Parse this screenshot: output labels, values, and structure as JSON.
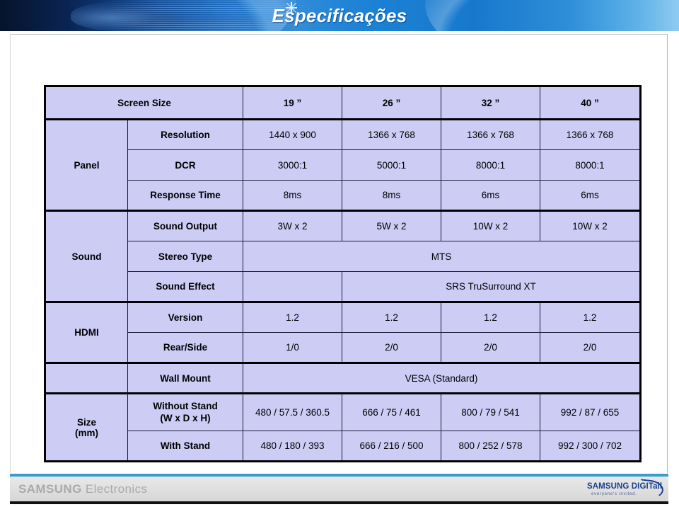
{
  "header": {
    "title": "Especificações",
    "sparkle_icon": "sparkle-icon"
  },
  "table": {
    "header_label": "Screen Size",
    "screen_sizes": [
      "19 ”",
      "26 ”",
      "32 ”",
      "40 ”"
    ],
    "categories": [
      "Panel",
      "Sound",
      "HDMI",
      "Size\n(mm)"
    ],
    "rows": [
      {
        "category": "Panel",
        "label": "Resolution",
        "values": [
          "1440 x 900",
          "1366 x 768",
          "1366 x 768",
          "1366 x 768"
        ]
      },
      {
        "category": "Panel",
        "label": "DCR",
        "values": [
          "3000:1",
          "5000:1",
          "8000:1",
          "8000:1"
        ]
      },
      {
        "category": "Panel",
        "label": "Response Time",
        "values": [
          "8ms",
          "8ms",
          "6ms",
          "6ms"
        ]
      },
      {
        "category": "Sound",
        "label": "Sound Output",
        "values": [
          "3W x 2",
          "5W x 2",
          "10W x 2",
          "10W x 2"
        ]
      },
      {
        "category": "Sound",
        "label": "Stereo Type",
        "merged_value": "MTS"
      },
      {
        "category": "Sound",
        "label": "Sound Effect",
        "first_value": "",
        "merged_value": "SRS TruSurround XT"
      },
      {
        "category": "HDMI",
        "label": "Version",
        "values": [
          "1.2",
          "1.2",
          "1.2",
          "1.2"
        ]
      },
      {
        "category": "HDMI",
        "label": "Rear/Side",
        "values": [
          "1/0",
          "2/0",
          "2/0",
          "2/0"
        ]
      },
      {
        "category": "Size (mm)",
        "label": "Wall Mount",
        "merged_value": "VESA (Standard)"
      },
      {
        "category": "Size (mm)",
        "label_line1": "Without Stand",
        "label_line2": "(W x D x H)",
        "values": [
          "480 / 57.5 / 360.5",
          "666 / 75 / 461",
          "800 / 79 / 541",
          "992 / 87 / 655"
        ]
      },
      {
        "category": "Size (mm)",
        "label": "With Stand",
        "values": [
          "480 / 180 / 393",
          "666 / 216 / 500",
          "800 / 252 / 578",
          "992 / 300 / 702"
        ]
      }
    ],
    "category_labels": {
      "panel": "Panel",
      "sound": "Sound",
      "hdmi": "HDMI",
      "size_line1": "Size",
      "size_line2": "(mm)"
    }
  },
  "footer": {
    "brand": "SAMSUNG",
    "brand_sub": " Electronics",
    "logo_main": "SAMSUNG DIGITall",
    "logo_tagline": "everyone's invited."
  },
  "colors": {
    "cell_fill": "#ccccf5",
    "cell_white": "#ffffff",
    "border": "#1b1b3a",
    "banner_blue": "#1878cc",
    "footer_rule": "#3a9ec9",
    "logo_blue": "#1b3f8f"
  }
}
